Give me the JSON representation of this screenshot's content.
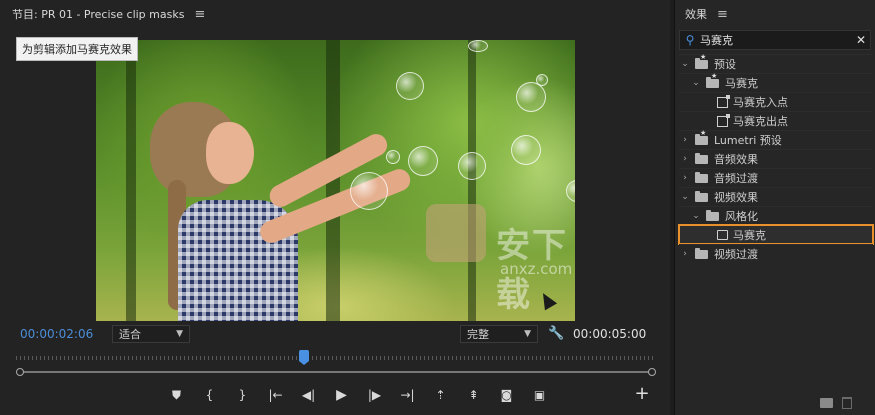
{
  "program": {
    "title": "节目: PR 01 - Precise clip masks",
    "menu_glyph": "≡",
    "tooltip": "为剪辑添加马赛克效果",
    "watermark": "安下载",
    "watermark_url": "anxz.com",
    "current_time": "00:00:02:06",
    "duration": "00:00:05:00",
    "fit_select": "适合",
    "resolution_select": "完整",
    "playhead_progress": 0.45
  },
  "transport": {
    "buttons": [
      {
        "name": "add-marker-button",
        "glyph": "⛊"
      },
      {
        "name": "mark-in-button",
        "glyph": "{"
      },
      {
        "name": "mark-out-button",
        "glyph": "}"
      },
      {
        "name": "go-to-in-button",
        "glyph": "|←"
      },
      {
        "name": "step-back-button",
        "glyph": "◀|"
      },
      {
        "name": "play-button",
        "glyph": "▶"
      },
      {
        "name": "step-forward-button",
        "glyph": "|▶"
      },
      {
        "name": "go-to-out-button",
        "glyph": "→|"
      },
      {
        "name": "lift-button",
        "glyph": "⇡"
      },
      {
        "name": "extract-button",
        "glyph": "⇞"
      },
      {
        "name": "export-frame-button",
        "glyph": "◙"
      },
      {
        "name": "compare-view-button",
        "glyph": "▣"
      }
    ],
    "plus_glyph": "+"
  },
  "effects": {
    "title": "效果",
    "menu_glyph": "≡",
    "search_value": "马赛克",
    "tree": [
      {
        "label": "预设",
        "level": 0,
        "expanded": true,
        "icon": "star-folder"
      },
      {
        "label": "马赛克",
        "level": 1,
        "expanded": true,
        "icon": "star-folder"
      },
      {
        "label": "马赛克入点",
        "level": 2,
        "icon": "preset"
      },
      {
        "label": "马赛克出点",
        "level": 2,
        "icon": "preset"
      },
      {
        "label": "Lumetri 预设",
        "level": 0,
        "expanded": false,
        "icon": "star-folder"
      },
      {
        "label": "音频效果",
        "level": 0,
        "expanded": false,
        "icon": "folder"
      },
      {
        "label": "音频过渡",
        "level": 0,
        "expanded": false,
        "icon": "folder"
      },
      {
        "label": "视频效果",
        "level": 0,
        "expanded": true,
        "icon": "folder"
      },
      {
        "label": "风格化",
        "level": 1,
        "expanded": true,
        "icon": "folder"
      },
      {
        "label": "马赛克",
        "level": 2,
        "icon": "effect",
        "selected": true
      },
      {
        "label": "视频过渡",
        "level": 0,
        "expanded": false,
        "icon": "folder"
      }
    ]
  },
  "colors": {
    "accent_blue": "#4a8fe0",
    "selection_orange": "#e8902a"
  }
}
